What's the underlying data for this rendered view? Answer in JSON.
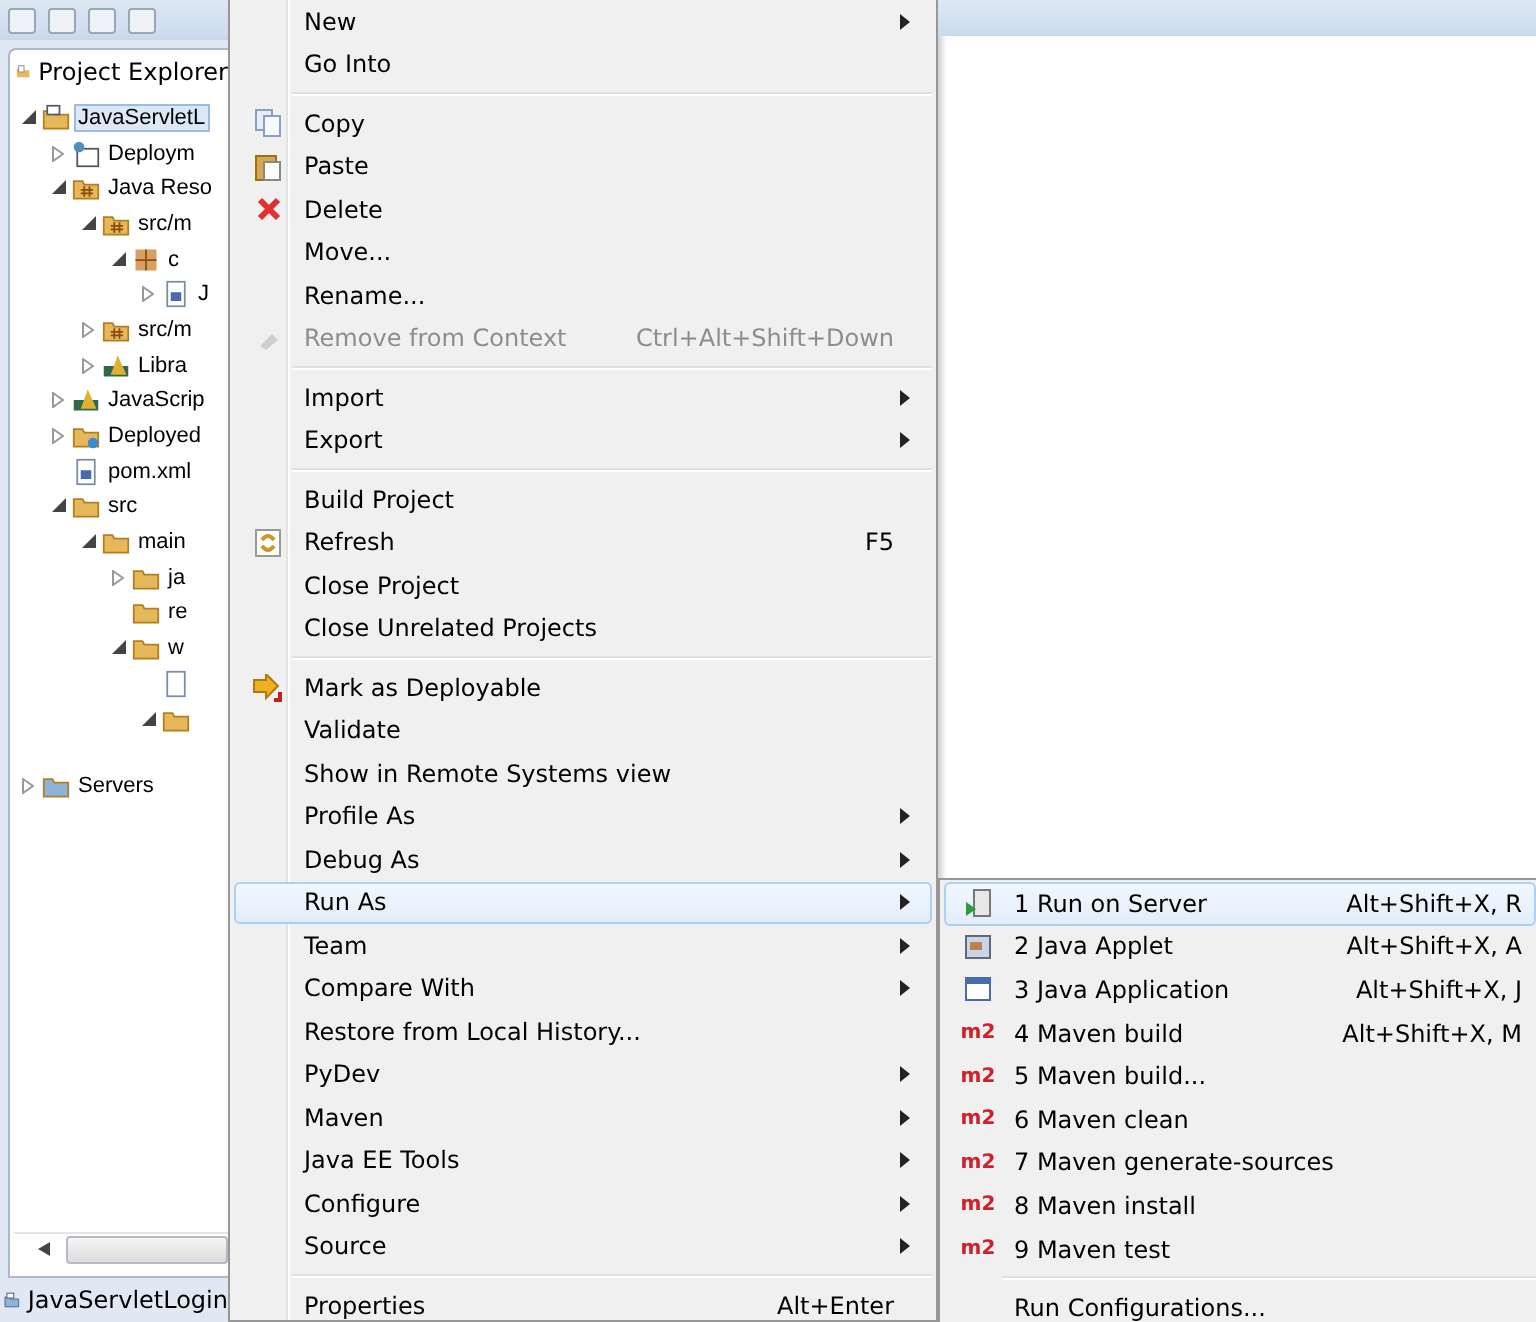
{
  "project_explorer": {
    "title": "Project Explorer",
    "tree": [
      {
        "label": "JavaServletL",
        "kind": "project",
        "expanded": true,
        "selected": true,
        "children": [
          {
            "label": "Deploym",
            "kind": "descriptor",
            "expanded": false,
            "selected": false
          },
          {
            "label": "Java Reso",
            "kind": "resources",
            "expanded": true,
            "selected": false,
            "children": [
              {
                "label": "src/m",
                "kind": "srcfolder",
                "expanded": true,
                "selected": false,
                "children": [
                  {
                    "label": "c",
                    "kind": "package",
                    "expanded": true,
                    "selected": false,
                    "children": [
                      {
                        "label": "J",
                        "kind": "javafile",
                        "expanded": false,
                        "selected": false
                      }
                    ]
                  }
                ]
              },
              {
                "label": "src/m",
                "kind": "srcfolder",
                "expanded": false,
                "selected": false
              },
              {
                "label": "Libra",
                "kind": "library",
                "expanded": false,
                "selected": false
              }
            ]
          },
          {
            "label": "JavaScrip",
            "kind": "library",
            "expanded": false,
            "selected": false
          },
          {
            "label": "Deployed",
            "kind": "deployed",
            "expanded": false,
            "selected": false
          },
          {
            "label": "pom.xml",
            "kind": "mfile",
            "selected": false
          },
          {
            "label": "src",
            "kind": "folder",
            "expanded": true,
            "selected": false,
            "children": [
              {
                "label": "main",
                "kind": "folder",
                "expanded": true,
                "selected": false,
                "children": [
                  {
                    "label": "ja",
                    "kind": "folder",
                    "expanded": false,
                    "selected": false
                  },
                  {
                    "label": "re",
                    "kind": "folder",
                    "selected": false
                  },
                  {
                    "label": "w",
                    "kind": "folder",
                    "expanded": true,
                    "selected": false,
                    "children": [
                      {
                        "kind": "textfile"
                      },
                      {
                        "kind": "folder",
                        "expanded": true
                      }
                    ]
                  }
                ]
              }
            ]
          }
        ]
      },
      {
        "label": "Servers",
        "kind": "servers",
        "expanded": false,
        "selected": false
      }
    ]
  },
  "status_bar": {
    "label": "JavaServletLogin"
  },
  "context_menu": [
    {
      "kind": "plain",
      "label": "New",
      "submenu": true,
      "selected": false,
      "disabled": false
    },
    {
      "kind": "plain",
      "label": "Go Into",
      "selected": false,
      "disabled": false
    },
    {
      "kind": "separator"
    },
    {
      "kind": "copy",
      "label": "Copy",
      "selected": false,
      "disabled": false
    },
    {
      "kind": "paste",
      "label": "Paste",
      "selected": false,
      "disabled": false
    },
    {
      "kind": "delete",
      "label": "Delete",
      "selected": false,
      "disabled": false
    },
    {
      "kind": "plain",
      "label": "Move...",
      "selected": false,
      "disabled": false
    },
    {
      "kind": "plain",
      "label": "Rename...",
      "selected": false,
      "disabled": false
    },
    {
      "kind": "remove",
      "label": "Remove from Context",
      "shortcut": "Ctrl+Alt+Shift+Down",
      "selected": false,
      "disabled": true
    },
    {
      "kind": "separator"
    },
    {
      "kind": "plain",
      "label": "Import",
      "submenu": true,
      "selected": false,
      "disabled": false
    },
    {
      "kind": "plain",
      "label": "Export",
      "submenu": true,
      "selected": false,
      "disabled": false
    },
    {
      "kind": "separator"
    },
    {
      "kind": "plain",
      "label": "Build Project",
      "selected": false,
      "disabled": false
    },
    {
      "kind": "refresh",
      "label": "Refresh",
      "shortcut": "F5",
      "selected": false,
      "disabled": false
    },
    {
      "kind": "plain",
      "label": "Close Project",
      "selected": false,
      "disabled": false
    },
    {
      "kind": "plain",
      "label": "Close Unrelated Projects",
      "selected": false,
      "disabled": false
    },
    {
      "kind": "separator"
    },
    {
      "kind": "deploy",
      "label": "Mark as Deployable",
      "selected": false,
      "disabled": false
    },
    {
      "kind": "plain",
      "label": "Validate",
      "selected": false,
      "disabled": false
    },
    {
      "kind": "plain",
      "label": "Show in Remote Systems view",
      "selected": false,
      "disabled": false
    },
    {
      "kind": "plain",
      "label": "Profile As",
      "submenu": true,
      "selected": false,
      "disabled": false
    },
    {
      "kind": "plain",
      "label": "Debug As",
      "submenu": true,
      "selected": false,
      "disabled": false
    },
    {
      "kind": "plain",
      "label": "Run As",
      "submenu": true,
      "selected": true,
      "disabled": false
    },
    {
      "kind": "plain",
      "label": "Team",
      "submenu": true,
      "selected": false,
      "disabled": false
    },
    {
      "kind": "plain",
      "label": "Compare With",
      "submenu": true,
      "selected": false,
      "disabled": false
    },
    {
      "kind": "plain",
      "label": "Restore from Local History...",
      "selected": false,
      "disabled": false
    },
    {
      "kind": "plain",
      "label": "PyDev",
      "submenu": true,
      "selected": false,
      "disabled": false
    },
    {
      "kind": "plain",
      "label": "Maven",
      "submenu": true,
      "selected": false,
      "disabled": false
    },
    {
      "kind": "plain",
      "label": "Java EE Tools",
      "submenu": true,
      "selected": false,
      "disabled": false
    },
    {
      "kind": "plain",
      "label": "Configure",
      "submenu": true,
      "selected": false,
      "disabled": false
    },
    {
      "kind": "plain",
      "label": "Source",
      "submenu": true,
      "selected": false,
      "disabled": false
    },
    {
      "kind": "separator"
    },
    {
      "kind": "plain",
      "label": "Properties",
      "shortcut": "Alt+Enter",
      "selected": false,
      "disabled": false
    }
  ],
  "run_as_menu": [
    {
      "kind": "server",
      "label": "1 Run on Server",
      "shortcut": "Alt+Shift+X, R",
      "selected": true
    },
    {
      "kind": "applet",
      "label": "2 Java Applet",
      "shortcut": "Alt+Shift+X, A",
      "selected": false
    },
    {
      "kind": "application",
      "label": "3 Java Application",
      "shortcut": "Alt+Shift+X, J",
      "selected": false
    },
    {
      "kind": "maven",
      "badge": "m2",
      "label": "4 Maven build",
      "shortcut": "Alt+Shift+X, M",
      "selected": false
    },
    {
      "kind": "maven",
      "badge": "m2",
      "label": "5 Maven build...",
      "selected": false
    },
    {
      "kind": "maven",
      "badge": "m2",
      "label": "6 Maven clean",
      "selected": false
    },
    {
      "kind": "maven",
      "badge": "m2",
      "label": "7 Maven generate-sources",
      "selected": false
    },
    {
      "kind": "maven",
      "badge": "m2",
      "label": "8 Maven install",
      "selected": false
    },
    {
      "kind": "maven",
      "badge": "m2",
      "label": "9 Maven test",
      "selected": false
    },
    {
      "kind": "separator"
    },
    {
      "kind": "plain",
      "label": "Run Configurations...",
      "selected": false
    }
  ]
}
